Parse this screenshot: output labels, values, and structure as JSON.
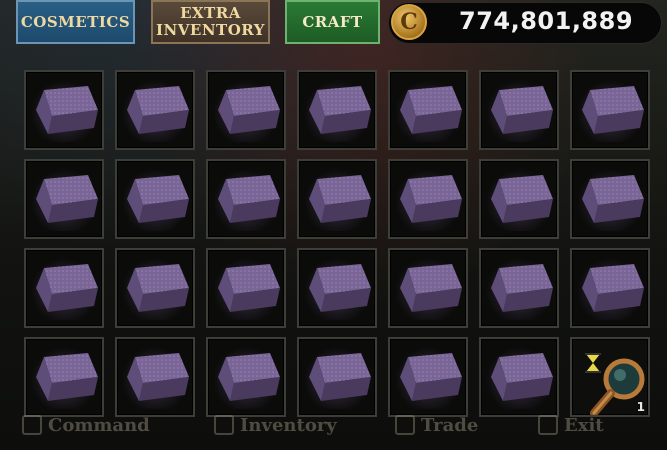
{
  "header": {
    "tabs": [
      {
        "label_line1": "COSMETICS",
        "label_line2": ""
      },
      {
        "label_line1": "EXTRA",
        "label_line2": "INVENTORY"
      },
      {
        "label_line1": "CRAFT",
        "label_line2": ""
      }
    ],
    "currency": {
      "icon": "gold-coin-icon",
      "coin_symbol": "C",
      "amount": "774,801,889"
    }
  },
  "inventory": {
    "rows": 4,
    "columns": 7,
    "item_icon": "purple-ingot-icon",
    "special_slot": {
      "icon": "magnifying-glass-icon",
      "badge_icon": "hourglass-icon",
      "quantity": "1"
    }
  },
  "bottom_nav": [
    {
      "label": "Command",
      "icon": "command-icon"
    },
    {
      "label": "Inventory",
      "icon": "inventory-icon"
    },
    {
      "label": "Trade",
      "icon": "trade-icon"
    },
    {
      "label": "Exit",
      "icon": "exit-icon"
    }
  ],
  "colors": {
    "cosmetics_tab": "#1d4a6c",
    "extra_inventory_tab": "#3e3227",
    "craft_tab": "#1d5c25",
    "ingot": "#5b4a72"
  }
}
